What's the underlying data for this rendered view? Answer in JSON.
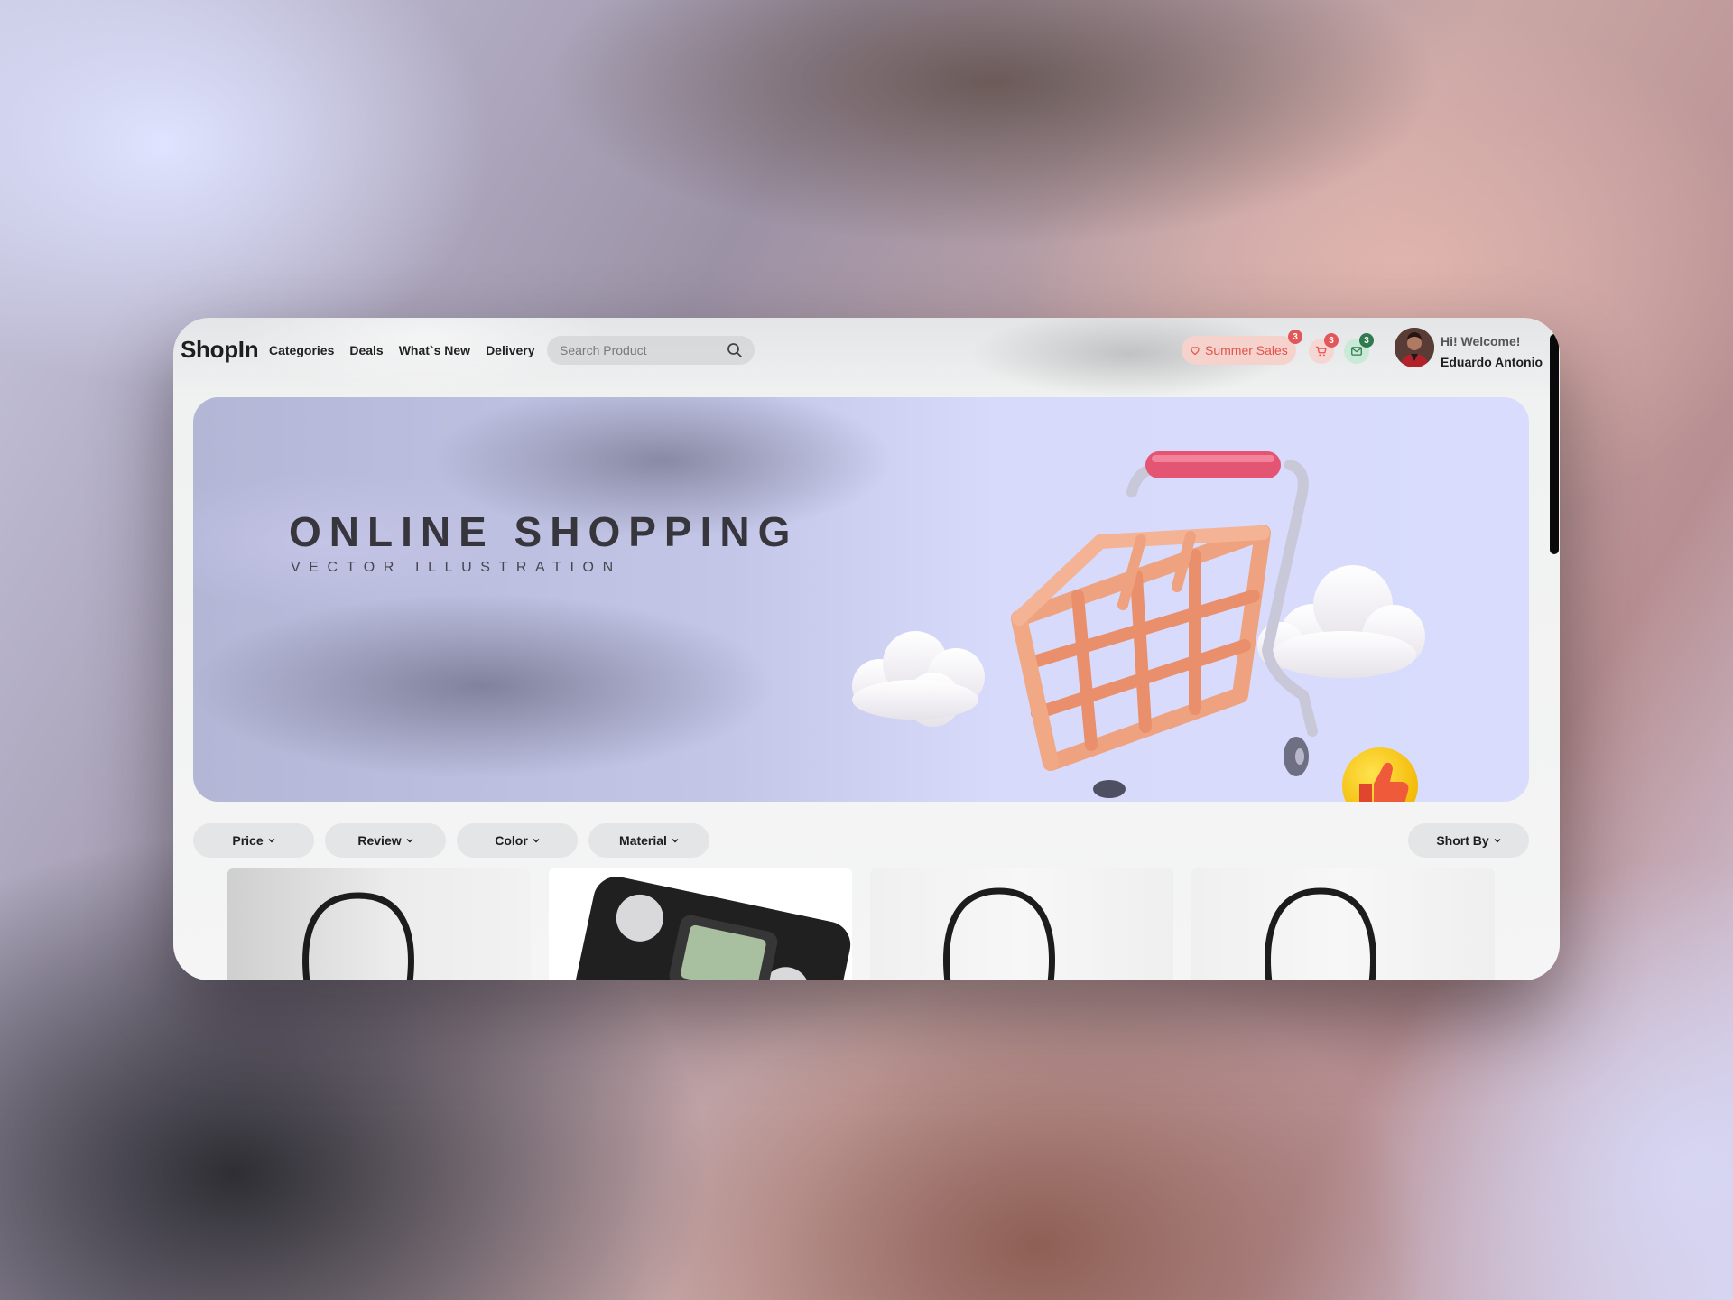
{
  "app": {
    "logo": "ShopIn"
  },
  "nav": {
    "items": [
      "Categories",
      "Deals",
      "What`s New",
      "Delivery"
    ]
  },
  "search": {
    "placeholder": "Search Product",
    "value": ""
  },
  "promo": {
    "label": "Summer Sales",
    "badge": "3"
  },
  "cart": {
    "badge": "3",
    "icon": "cart-icon"
  },
  "messages": {
    "badge": "3",
    "icon": "mail-icon"
  },
  "user": {
    "greeting": "Hi! Welcome!",
    "name": "Eduardo Antonio"
  },
  "hero": {
    "title": "ONLINE SHOPPING",
    "subtitle": "VECTOR ILLUSTRATION"
  },
  "filters": {
    "items": [
      "Price",
      "Review",
      "Color",
      "Material"
    ],
    "sort": "Short By"
  },
  "colors": {
    "accent": "#e2534b",
    "promo_bg": "#f5d2cc",
    "success": "#2f7a4f",
    "hero_bg": "#d9dcfd"
  },
  "products": [
    {
      "icon": "jump-rope-icon"
    },
    {
      "icon": "scale-icon"
    },
    {
      "icon": "jump-rope-icon"
    },
    {
      "icon": "jump-rope-icon"
    }
  ]
}
